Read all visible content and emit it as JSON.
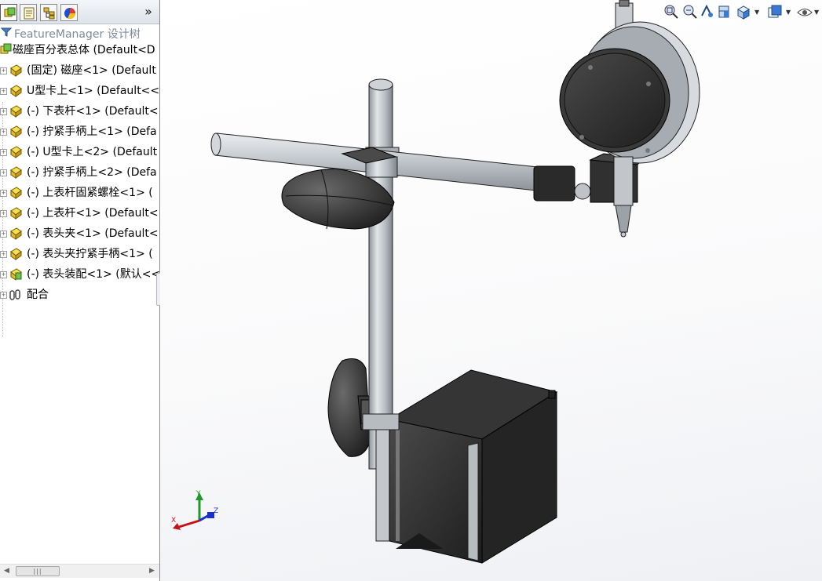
{
  "feature_manager": {
    "filter_placeholder": "FeatureManager 设计树",
    "expand_symbol": "»",
    "tabs": [
      {
        "name": "featuremanager-tab",
        "icon": "assembly-tree-icon"
      },
      {
        "name": "propertymanager-tab",
        "icon": "property-sheet-icon"
      },
      {
        "name": "configurationmanager-tab",
        "icon": "configuration-icon"
      },
      {
        "name": "displaymanager-tab",
        "icon": "appearance-pie-icon"
      }
    ],
    "root": {
      "label": "磁座百分表总体  (Default<D",
      "icon": "assembly-icon"
    },
    "components": [
      {
        "label": "(固定) 磁座<1> (Default"
      },
      {
        "label": "U型卡上<1> (Default<<"
      },
      {
        "label": "(-) 下表杆<1> (Default<"
      },
      {
        "label": "(-) 拧紧手柄上<1> (Defa"
      },
      {
        "label": "(-) U型卡上<2> (Default"
      },
      {
        "label": "(-) 拧紧手柄上<2> (Defa"
      },
      {
        "label": "(-) 上表杆固紧螺栓<1> ("
      },
      {
        "label": "(-) 上表杆<1> (Default<"
      },
      {
        "label": "(-) 表头夹<1> (Default<"
      },
      {
        "label": "(-) 表头夹拧紧手柄<1> ("
      },
      {
        "label": "(-) 表头装配<1> (默认<<"
      }
    ],
    "mates": {
      "label": "配合",
      "icon": "mates-icon"
    },
    "scrollbar_grip": "|||"
  },
  "heads_up_toolbar": [
    {
      "name": "zoom-to-fit-icon",
      "dropdown": false
    },
    {
      "name": "zoom-to-area-icon",
      "dropdown": false
    },
    {
      "name": "previous-view-icon",
      "dropdown": false
    },
    {
      "name": "section-view-icon",
      "dropdown": false
    },
    {
      "name": "view-orientation-icon",
      "dropdown": true
    },
    {
      "name": "display-style-icon",
      "dropdown": true
    },
    {
      "name": "hide-show-items-icon",
      "dropdown": true
    },
    {
      "name": "edit-appearance-icon",
      "dropdown": false
    },
    {
      "name": "apply-scene-icon",
      "dropdown": true
    },
    {
      "name": "view-settings-icon",
      "dropdown": true
    }
  ],
  "triad": {
    "x_label": "X",
    "y_label": "Y",
    "z_label": "Z"
  },
  "colors": {
    "x_axis": "#c8121a",
    "y_axis": "#1f9a2a",
    "z_axis": "#1a2fd0",
    "part_dark": "#2e2e2e",
    "rod": "#b9bec4"
  }
}
